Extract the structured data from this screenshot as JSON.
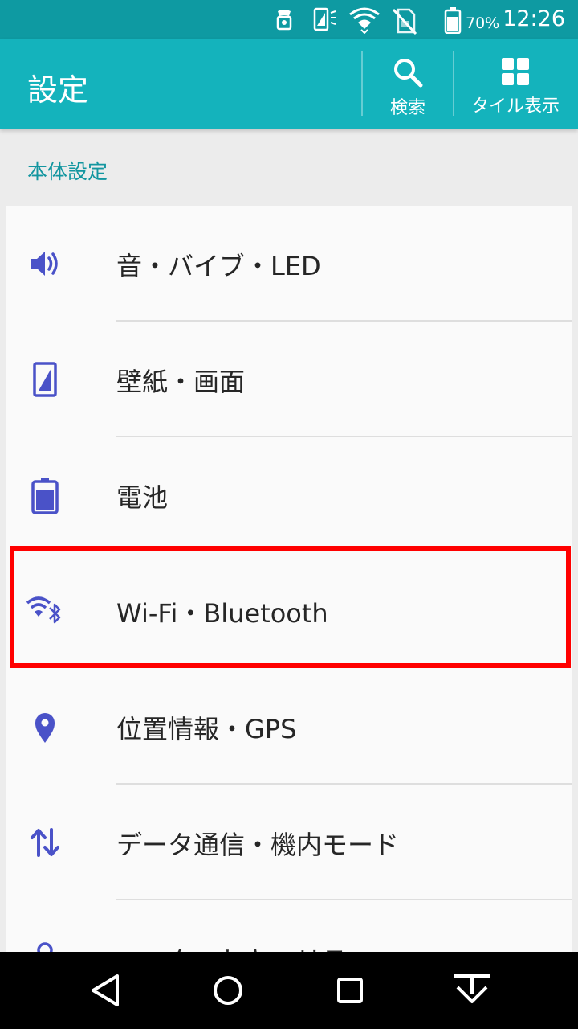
{
  "status_bar": {
    "battery_percent": "70%",
    "time": "12:26",
    "icons": [
      "notification-icon",
      "screen-rotation-icon",
      "wifi-icon",
      "no-sim-icon",
      "battery-icon"
    ]
  },
  "app_bar": {
    "title": "設定",
    "search_label": "検索",
    "tile_label": "タイル表示"
  },
  "section": {
    "header": "本体設定"
  },
  "items": [
    {
      "label": "音・バイブ・LED",
      "icon": "volume-icon"
    },
    {
      "label": "壁紙・画面",
      "icon": "display-icon"
    },
    {
      "label": "電池",
      "icon": "battery-icon"
    },
    {
      "label": "Wi-Fi・Bluetooth",
      "icon": "wifi-bluetooth-icon"
    },
    {
      "label": "位置情報・GPS",
      "icon": "location-icon"
    },
    {
      "label": "データ通信・機内モード",
      "icon": "data-transfer-icon"
    },
    {
      "label": "ロック・セキュリティ",
      "icon": "lock-icon"
    }
  ],
  "nav_bar": {
    "buttons": [
      "back-icon",
      "home-icon",
      "recents-icon",
      "notification-pull-icon"
    ]
  },
  "colors": {
    "status_bar": "#0e9aa2",
    "app_bar": "#14b3bc",
    "accent": "#1396a0",
    "icon": "#4a52c8",
    "highlight": "#ff0000"
  }
}
